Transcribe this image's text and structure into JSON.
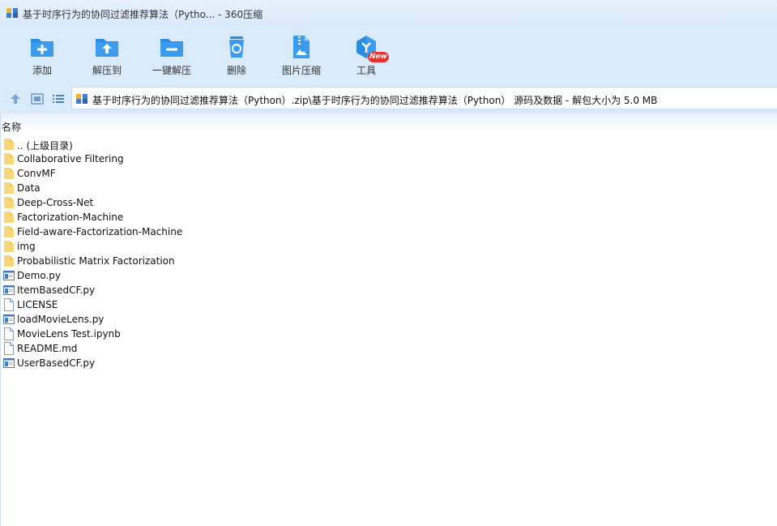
{
  "window": {
    "title": "基于时序行为的协同过滤推荐算法（Pytho... - 360压缩"
  },
  "toolbar": {
    "buttons": [
      {
        "label": "添加",
        "icon": "add-icon"
      },
      {
        "label": "解压到",
        "icon": "extract-to-icon"
      },
      {
        "label": "一键解压",
        "icon": "one-click-extract-icon"
      },
      {
        "label": "删除",
        "icon": "recycle-bin-icon"
      },
      {
        "label": "图片压缩",
        "icon": "image-compress-icon"
      },
      {
        "label": "工具",
        "icon": "tools-icon"
      }
    ],
    "badge": "New"
  },
  "addressbar": {
    "path": "基于时序行为的协同过滤推荐算法（Python）.zip\\基于时序行为的协同过滤推荐算法（Python） 源码及数据 - 解包大小为 5.0 MB"
  },
  "filelist": {
    "column_name": "名称",
    "items": [
      {
        "name": ".. (上级目录)",
        "type": "folder"
      },
      {
        "name": "Collaborative Filtering",
        "type": "folder"
      },
      {
        "name": "ConvMF",
        "type": "folder"
      },
      {
        "name": "Data",
        "type": "folder"
      },
      {
        "name": "Deep-Cross-Net",
        "type": "folder"
      },
      {
        "name": "Factorization-Machine",
        "type": "folder"
      },
      {
        "name": "Field-aware-Factorization-Machine",
        "type": "folder"
      },
      {
        "name": "img",
        "type": "folder"
      },
      {
        "name": "Probabilistic Matrix Factorization",
        "type": "folder"
      },
      {
        "name": "Demo.py",
        "type": "py"
      },
      {
        "name": "ItemBasedCF.py",
        "type": "py"
      },
      {
        "name": "LICENSE",
        "type": "file"
      },
      {
        "name": "loadMovieLens.py",
        "type": "py"
      },
      {
        "name": "MovieLens Test.ipynb",
        "type": "file"
      },
      {
        "name": "README.md",
        "type": "file"
      },
      {
        "name": "UserBasedCF.py",
        "type": "py"
      }
    ]
  }
}
